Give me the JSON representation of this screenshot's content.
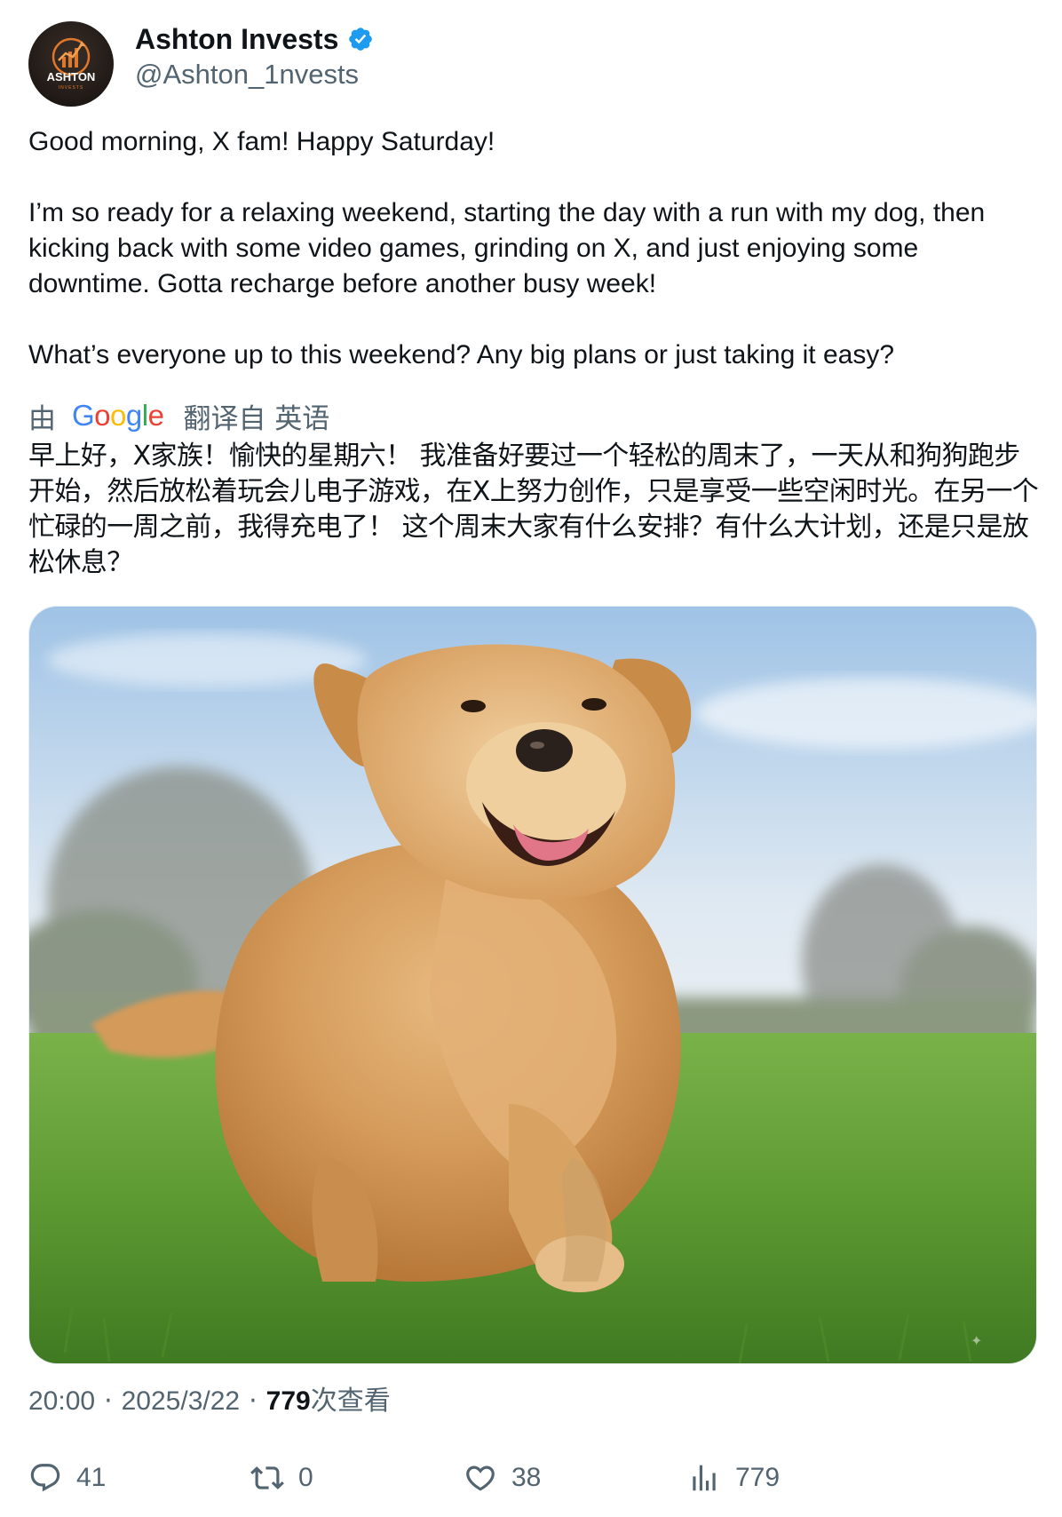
{
  "author": {
    "display_name": "Ashton Invests",
    "handle": "@Ashton_1nvests",
    "verified": true,
    "avatar_text": "ASHTON",
    "avatar_subtext": "INVESTS"
  },
  "tweet": {
    "paragraphs": [
      "Good morning, X fam! Happy Saturday!",
      "I’m so ready for a relaxing weekend, starting the day with a run with my dog, then kicking back with some video games, grinding on X, and just enjoying some downtime. Gotta recharge before another busy week!",
      "What’s everyone up to this weekend? Any big plans or just taking it easy?"
    ]
  },
  "translation": {
    "by_label": "由",
    "provider": "Google",
    "from_label": "翻译自 英语",
    "text": "早上好，X家族！愉快的星期六！ 我准备好要过一个轻松的周末了，一天从和狗狗跑步开始，然后放松着玩会儿电子游戏，在X上努力创作，只是享受一些空闲时光。在另一个忙碌的一周之前，我得充电了！ 这个周末大家有什么安排？有什么大计划，还是只是放松休息？"
  },
  "meta": {
    "time": "20:00",
    "date": "2025/3/22",
    "views_count": "779",
    "views_label": "次查看"
  },
  "actions": {
    "replies": "41",
    "retweets": "0",
    "likes": "38",
    "views": "779"
  },
  "colors": {
    "text_primary": "#0f1419",
    "text_secondary": "#536471",
    "verified_blue": "#1d9bf0"
  }
}
